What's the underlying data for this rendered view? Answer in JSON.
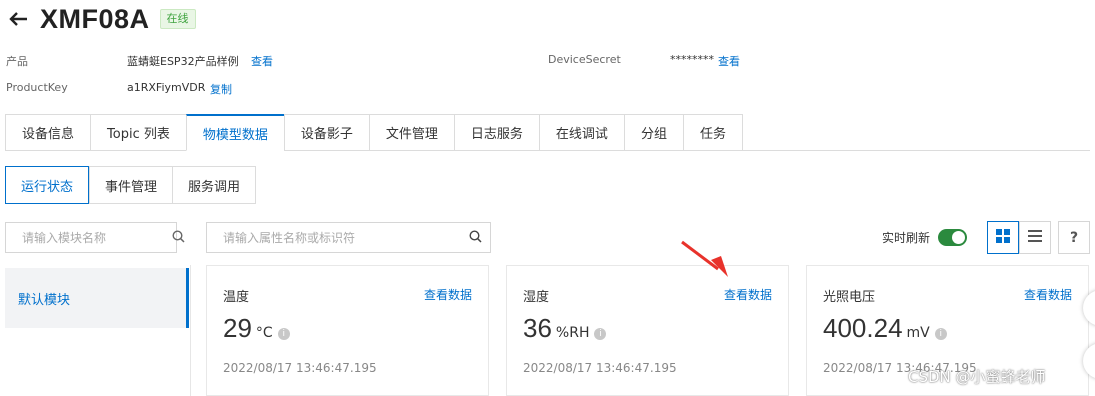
{
  "header": {
    "device_name": "XMF08A",
    "status": "在线"
  },
  "info": {
    "product_label": "产品",
    "product_value": "蓝蜻蜓ESP32产品样例",
    "product_action": "查看",
    "productkey_label": "ProductKey",
    "productkey_value": "a1RXFiymVDR",
    "productkey_action": "复制",
    "devicesecret_label": "DeviceSecret",
    "devicesecret_value": "********",
    "devicesecret_action": "查看"
  },
  "tabs": [
    {
      "label": "设备信息"
    },
    {
      "label": "Topic 列表"
    },
    {
      "label": "物模型数据"
    },
    {
      "label": "设备影子"
    },
    {
      "label": "文件管理"
    },
    {
      "label": "日志服务"
    },
    {
      "label": "在线调试"
    },
    {
      "label": "分组"
    },
    {
      "label": "任务"
    }
  ],
  "active_tab": "物模型数据",
  "subtabs": [
    {
      "label": "运行状态"
    },
    {
      "label": "事件管理"
    },
    {
      "label": "服务调用"
    }
  ],
  "active_subtab": "运行状态",
  "module_search": {
    "placeholder": "请输入模块名称"
  },
  "property_search": {
    "placeholder": "请输入属性名称或标识符"
  },
  "modules": [
    {
      "label": "默认模块"
    }
  ],
  "realtime": {
    "label": "实时刷新",
    "enabled": true
  },
  "help_label": "?",
  "cards": [
    {
      "title": "温度",
      "link": "查看数据",
      "value": "29",
      "unit": "°C",
      "time": "2022/08/17 13:46:47.195"
    },
    {
      "title": "湿度",
      "link": "查看数据",
      "value": "36",
      "unit": "%RH",
      "time": "2022/08/17 13:46:47.195"
    },
    {
      "title": "光照电压",
      "link": "查看数据",
      "value": "400.24",
      "unit": "mV",
      "time": "2022/08/17 13:46:47.195"
    }
  ],
  "watermark": "CSDN @小蜜蜂老师",
  "colors": {
    "accent": "#0070cc",
    "online_bg": "#e9f6e5",
    "online_text": "#3fa33f",
    "toggle_on": "#2b8a3e",
    "annotation_arrow": "#e8322b"
  }
}
